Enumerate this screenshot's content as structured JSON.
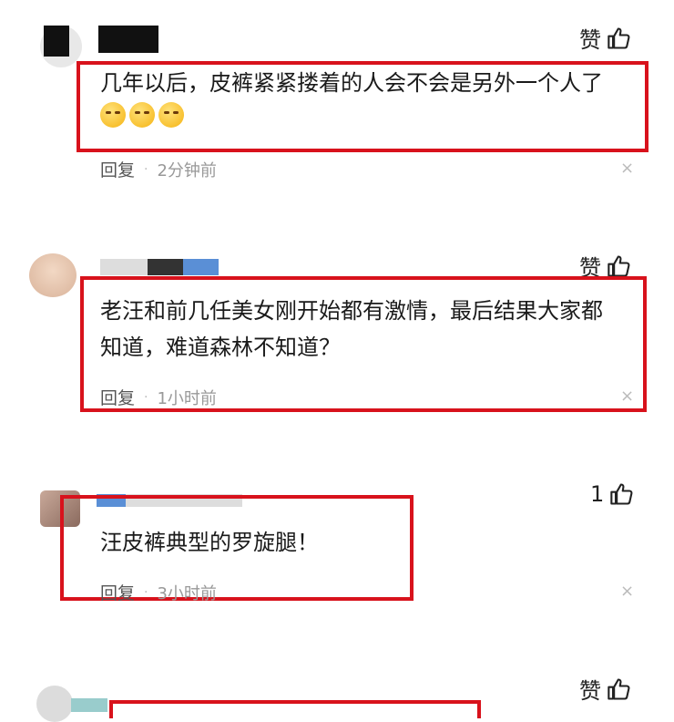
{
  "comments": [
    {
      "like_label": "赞",
      "text": "几年以后，皮裤紧紧搂着的人会不会是另外一个人了",
      "emojis": [
        "sly-face-emoji",
        "sly-face-emoji",
        "sly-face-emoji"
      ],
      "reply_label": "回复",
      "separator": "·",
      "time": "2分钟前",
      "close": "×"
    },
    {
      "like_label": "赞",
      "text_line1": "老汪和前几任美女刚开始都有激情，最后结果大家都",
      "text_line2": "知道，难道森林不知道？",
      "reply_label": "回复",
      "separator": "·",
      "time": "1小时前",
      "close": "×"
    },
    {
      "like_label": "1",
      "text": "汪皮裤典型的罗旋腿！",
      "reply_label": "回复",
      "separator": "·",
      "time": "3小时前",
      "close": "×"
    },
    {
      "like_label": "赞"
    }
  ],
  "colors": {
    "highlight_border": "#d8121c",
    "meta_text": "#999999"
  }
}
